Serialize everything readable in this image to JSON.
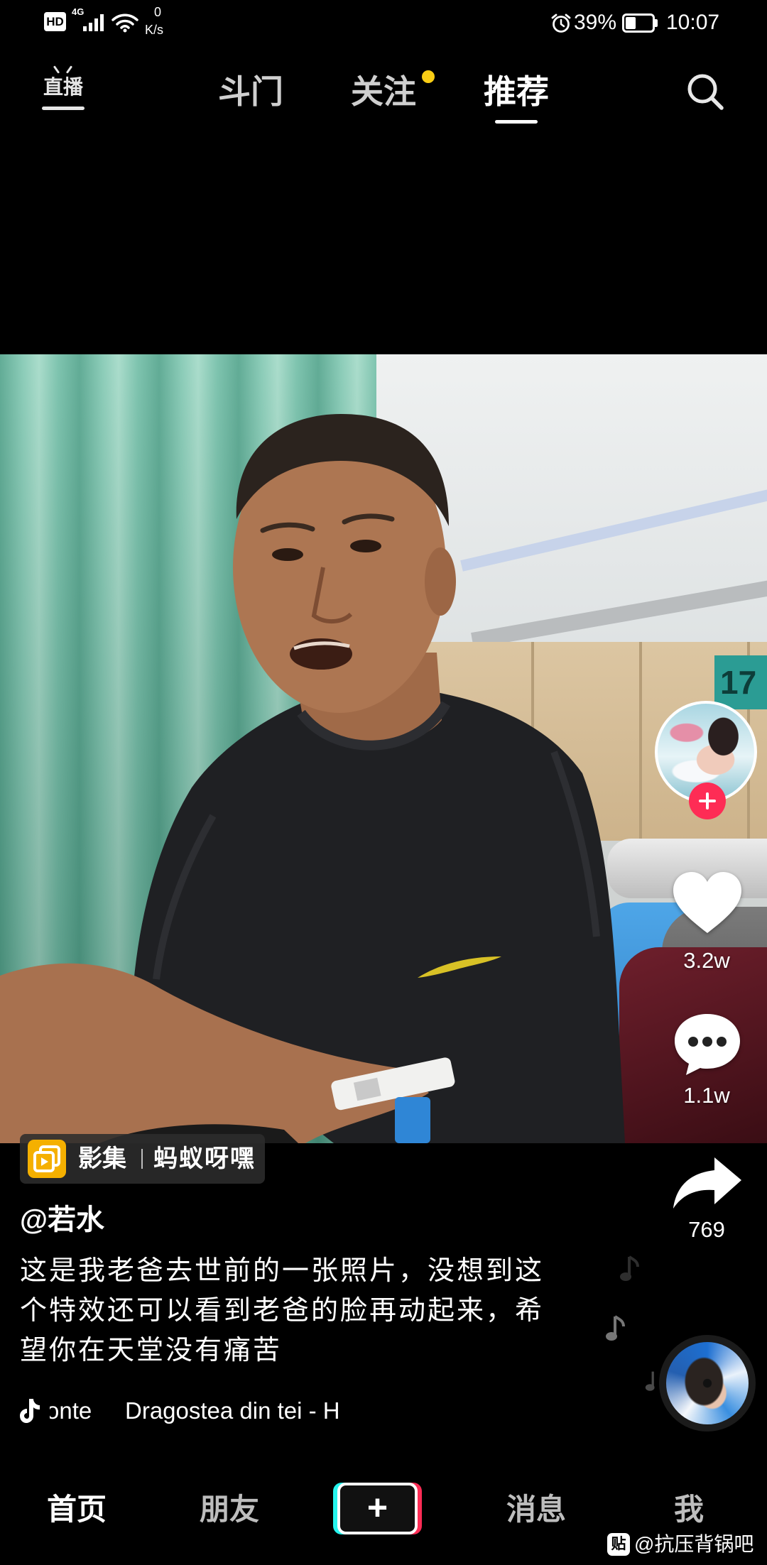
{
  "status_bar": {
    "hd_badge": "HD",
    "network": "4G",
    "speed_value": "0",
    "speed_unit": "K/s",
    "battery_percent": "39%",
    "battery_level": 0.39,
    "time": "10:07",
    "icons": [
      "signal-icon",
      "wifi-icon",
      "alarm-icon",
      "battery-icon"
    ]
  },
  "top_nav": {
    "live_label": "直播",
    "tabs": [
      {
        "label": "斗门",
        "active": false,
        "has_new_dot": false
      },
      {
        "label": "关注",
        "active": false,
        "has_new_dot": true
      },
      {
        "label": "推荐",
        "active": true,
        "has_new_dot": false
      }
    ],
    "search_icon": "search-icon"
  },
  "video": {
    "scene_sign": "17"
  },
  "actions": {
    "creator_avatar": "avatar-image",
    "follow_icon": "plus-icon",
    "like_icon": "heart-icon",
    "likes": "3.2w",
    "comment_icon": "comment-icon",
    "comments": "1.1w",
    "share_icon": "share-icon",
    "shares": "769",
    "music_disc": "music-disc-icon"
  },
  "post": {
    "collection_icon": "collection-icon",
    "collection_tag": "影集",
    "effect_name": "蚂蚁呀嘿",
    "author": "@若水",
    "description_lines": [
      "这是我老爸去世前的一张照片，没想到这",
      "个特效还可以看到老爸的脸再动起来，希",
      "望你在天堂没有痛苦"
    ],
    "music_icon": "music-note-icon",
    "music_prefix": "onte",
    "music_title": "Dragostea din tei - H"
  },
  "bottom_nav": {
    "items": [
      {
        "label": "首页",
        "active": true
      },
      {
        "label": "朋友",
        "active": false
      },
      {
        "label": "+",
        "active": false
      },
      {
        "label": "消息",
        "active": false
      },
      {
        "label": "我",
        "active": false
      }
    ]
  },
  "watermark": {
    "logo_text": "贴",
    "text": "@抗压背锅吧"
  },
  "colors": {
    "background": "#000000",
    "accent": "#FE2C55",
    "new_dot": "#FACE15",
    "collection_icon_bg": "#F5B000",
    "create_left": "#25F4EE",
    "create_right": "#FE2C55"
  }
}
